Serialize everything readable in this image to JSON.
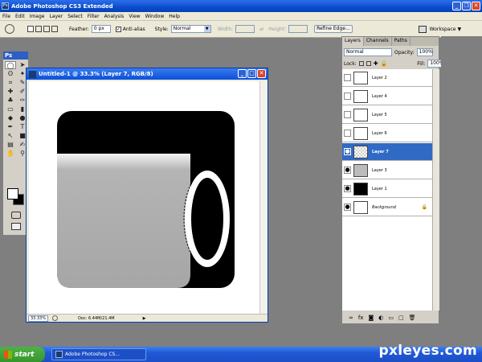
{
  "app": {
    "title": "Adobe Photoshop CS3 Extended",
    "ps_badge": "Ps"
  },
  "menu": [
    "File",
    "Edit",
    "Image",
    "Layer",
    "Select",
    "Filter",
    "Analysis",
    "View",
    "Window",
    "Help"
  ],
  "options": {
    "feather_label": "Feather:",
    "feather_value": "0 px",
    "antialias_label": "Anti-alias",
    "style_label": "Style:",
    "style_value": "Normal",
    "width_label": "Width:",
    "height_label": "Height:",
    "refine_edge": "Refine Edge...",
    "workspace": "Workspace"
  },
  "document": {
    "title": "Untitled-1 @ 33.3% (Layer 7, RGB/8)",
    "zoom": "33.33%",
    "doc_info": "Doc: 6.44M/21.4M"
  },
  "layers_panel": {
    "tabs": [
      "Layers",
      "Channels",
      "Paths"
    ],
    "blend_mode": "Normal",
    "opacity_label": "Opacity:",
    "opacity_value": "100%",
    "lock_label": "Lock:",
    "fill_label": "Fill:",
    "fill_value": "100%",
    "layers": [
      {
        "name": "Layer 2",
        "visible": false,
        "selected": false
      },
      {
        "name": "Layer 4",
        "visible": false,
        "selected": false
      },
      {
        "name": "Layer 5",
        "visible": false,
        "selected": false
      },
      {
        "name": "Layer 6",
        "visible": false,
        "selected": false
      },
      {
        "name": "Layer 7",
        "visible": true,
        "selected": true
      },
      {
        "name": "Layer 3",
        "visible": true,
        "selected": false
      },
      {
        "name": "Layer 1",
        "visible": true,
        "selected": false
      },
      {
        "name": "Background",
        "visible": true,
        "selected": false,
        "locked": true
      }
    ]
  },
  "taskbar": {
    "start": "start",
    "task": "Adobe Photoshop CS..."
  },
  "watermark": "pxleyes.com",
  "colors": {
    "xp_blue": "#0a4ccf",
    "selection": "#316ac5",
    "panel": "#d4d0c8"
  }
}
